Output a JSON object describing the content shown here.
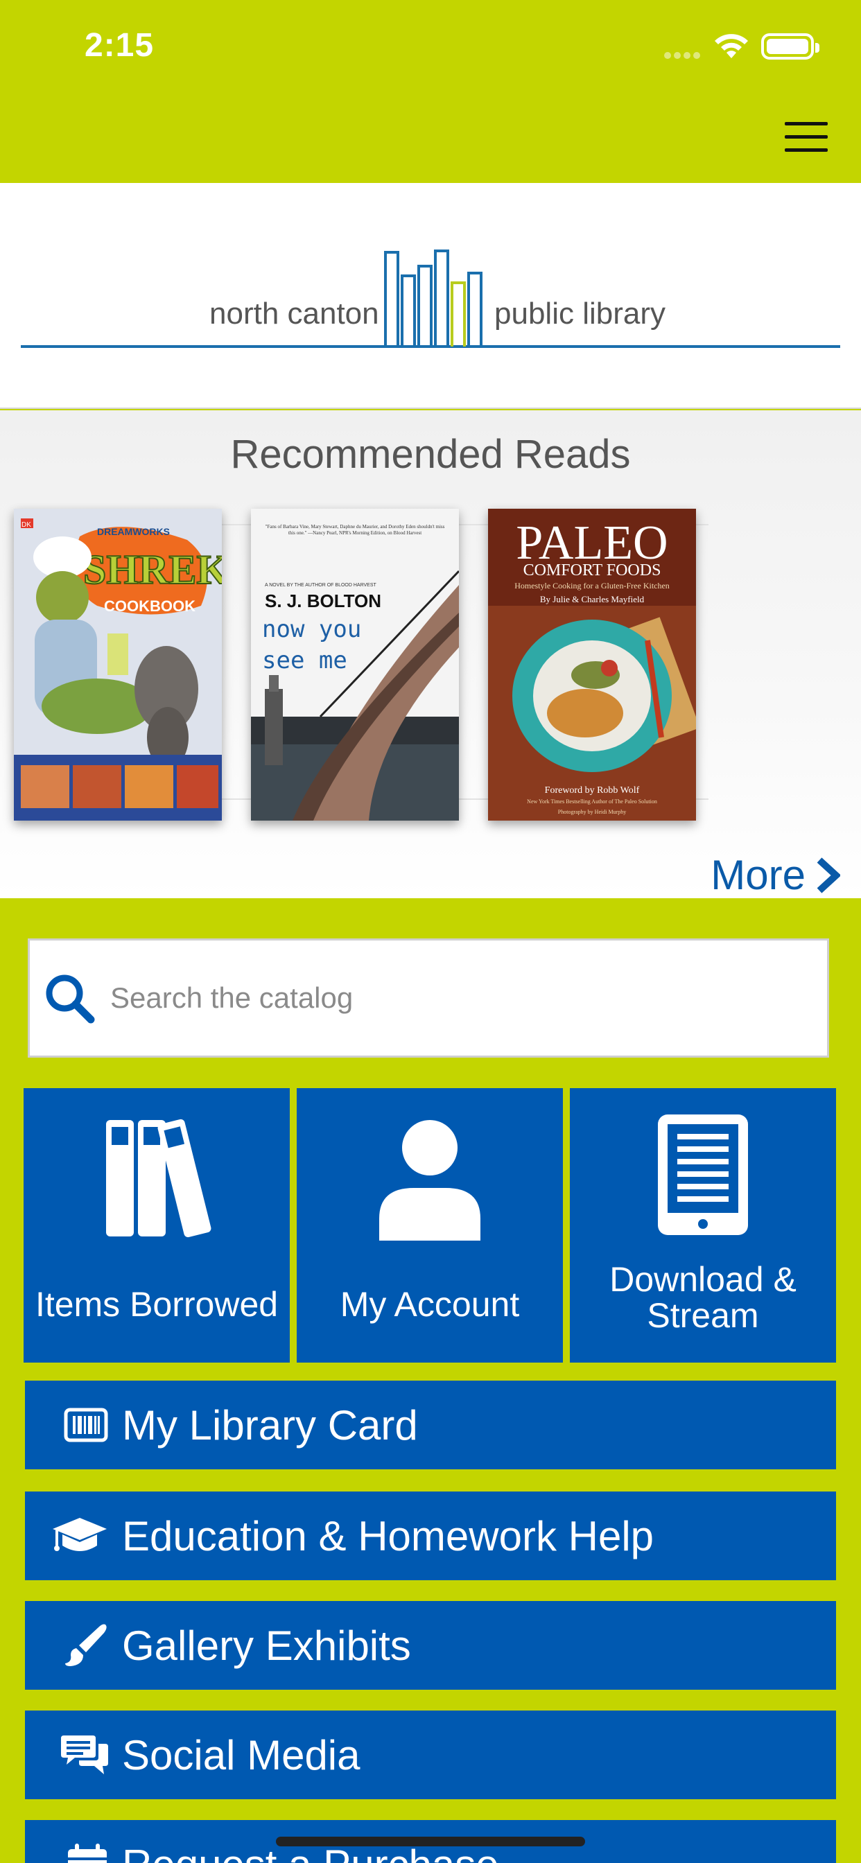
{
  "status_bar": {
    "time": "2:15"
  },
  "header": {
    "menu_icon": "hamburger-menu-icon"
  },
  "logo": {
    "left_text": "north canton",
    "right_text": "public library",
    "line_color": "#1a6fad",
    "accent_color": "#b8cc1e"
  },
  "recommended": {
    "title": "Recommended Reads",
    "books": [
      {
        "title": "SHREK",
        "subtitle": "COOKBOOK",
        "brand": "DREAMWORKS",
        "publisher_mark": "DK"
      },
      {
        "blurb": "\"Fans of Barbara Vine, Mary Stewart, Daphne du Maurier, and Dorothy Eden shouldn't miss this one.\" —Nancy Pearl, NPR's Morning Edition, on Blood Harvest",
        "tagline": "A NOVEL BY THE AUTHOR OF BLOOD HARVEST",
        "author": "S. J. BOLTON",
        "title_line1": "now you",
        "title_line2": "see me"
      },
      {
        "title": "PALEO",
        "subtitle": "COMFORT FOODS",
        "tagline": "Homestyle Cooking for a Gluten-Free Kitchen",
        "authors": "By Julie & Charles Mayfield",
        "foreword": "Foreword by Robb Wolf",
        "foreword_note": "New York Times Bestselling Author of The Paleo Solution",
        "photo_credit": "Photography by Heidi Murphy"
      }
    ],
    "more_label": "More"
  },
  "search": {
    "placeholder": "Search the catalog"
  },
  "tiles": [
    {
      "label": "Items Borrowed",
      "icon": "books-icon"
    },
    {
      "label": "My Account",
      "icon": "user-icon"
    },
    {
      "label_line1": "Download &",
      "label_line2": "Stream",
      "icon": "tablet-icon"
    }
  ],
  "rows": [
    {
      "label": "My Library Card",
      "icon": "barcode-card-icon"
    },
    {
      "label": "Education & Homework Help",
      "icon": "graduation-cap-icon"
    },
    {
      "label": "Gallery Exhibits",
      "icon": "paint-brush-icon"
    },
    {
      "label": "Social Media",
      "icon": "chat-bubbles-icon"
    },
    {
      "label": "Request a Purchase",
      "icon": "calendar-icon"
    }
  ],
  "colors": {
    "lime": "#c3d500",
    "blue": "#0059b1",
    "link_blue": "#0a5aa8"
  }
}
